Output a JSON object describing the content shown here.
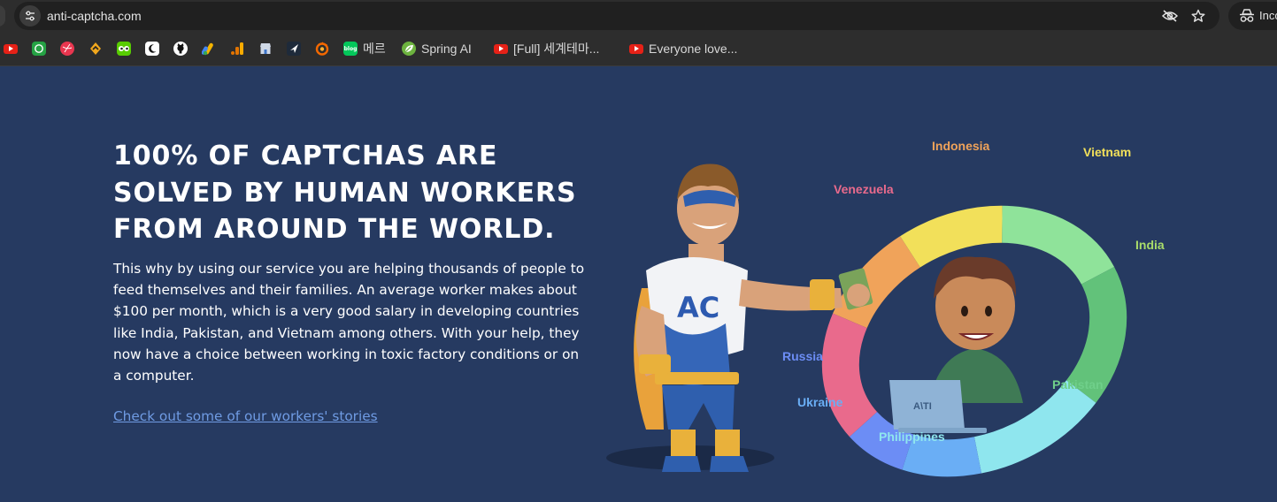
{
  "browser": {
    "url": "anti-captcha.com",
    "profile_label": "Incognito",
    "icons": [
      "site-info-icon",
      "eye-off-icon",
      "star-icon",
      "incognito-icon"
    ],
    "bookmarks": [
      {
        "icon": "youtube-icon",
        "label": ""
      },
      {
        "icon": "whatsapp-icon",
        "label": ""
      },
      {
        "icon": "dribbble-icon",
        "label": ""
      },
      {
        "icon": "hashnode-icon",
        "label": ""
      },
      {
        "icon": "duolingo-icon",
        "label": ""
      },
      {
        "icon": "moon-icon",
        "label": ""
      },
      {
        "icon": "github-icon",
        "label": ""
      },
      {
        "icon": "google-ads-icon",
        "label": ""
      },
      {
        "icon": "analytics-icon",
        "label": ""
      },
      {
        "icon": "store-icon",
        "label": ""
      },
      {
        "icon": "cursor-icon",
        "label": ""
      },
      {
        "icon": "grafana-icon",
        "label": ""
      },
      {
        "icon": "naver-blog-icon",
        "label": "메르"
      },
      {
        "icon": "spring-icon",
        "label": "Spring AI"
      },
      {
        "icon": "youtube-icon",
        "label": "[Full] 세계테마..."
      },
      {
        "icon": "youtube-icon",
        "label": "Everyone love..."
      }
    ]
  },
  "page": {
    "headline": "100% OF CAPTCHAS ARE SOLVED BY HUMAN WORKERS FROM AROUND THE WORLD.",
    "body": "This why by using our service you are helping thousands of people to feed themselves and their families. An average worker makes about $100 per month, which is a very good salary in developing countries like India, Pakistan, and Vietnam among others. With your help, they now have a choice between working in toxic factory conditions or on a computer.",
    "stories_link": "Check out some of our workers' stories",
    "mascot_badge": "AC",
    "laptop_logo": "A\\TI",
    "countries": [
      {
        "name": "Indonesia",
        "color": "#f0a35a"
      },
      {
        "name": "Vietnam",
        "color": "#f2e05a"
      },
      {
        "name": "Venezuela",
        "color": "#e96a8c"
      },
      {
        "name": "India",
        "color": "#a9dc6a"
      },
      {
        "name": "Russia",
        "color": "#6c8df5"
      },
      {
        "name": "Pakistan",
        "color": "#6fcf8a"
      },
      {
        "name": "Ukraine",
        "color": "#6aaef5"
      },
      {
        "name": "Philippines",
        "color": "#8fe6ee"
      }
    ]
  }
}
